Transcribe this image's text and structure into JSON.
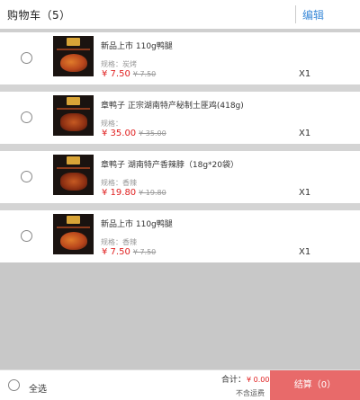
{
  "header": {
    "title": "购物车（5）",
    "edit_label": "编辑"
  },
  "items": [
    {
      "name": "新品上市 110g鸭腿",
      "spec": "规格：炭烤",
      "price": "¥ 7.50",
      "old_price": "¥ 7.50",
      "qty": "X1"
    },
    {
      "name": "章鸭子 正宗湖南特产秘制土匪鸡(418g)",
      "spec": "规格：",
      "price": "¥ 35.00",
      "old_price": "¥ 35.00",
      "qty": "X1"
    },
    {
      "name": "章鸭子 湖南特产香辣脖（18g*20袋）",
      "spec": "规格：香辣",
      "price": "¥ 19.80",
      "old_price": "¥ 19.80",
      "qty": "X1"
    },
    {
      "name": "新品上市 110g鸭腿",
      "spec": "规格：香辣",
      "price": "¥ 7.50",
      "old_price": "¥ 7.50",
      "qty": "X1"
    }
  ],
  "footer": {
    "select_all_label": "全选",
    "total_label": "合计：",
    "total_amount": "¥ 0.00",
    "shipping_note": "不含运费",
    "checkout_label": "结算（0）"
  },
  "colors": {
    "accent": "#3b8ad8",
    "price": "#e02020",
    "checkout": "#e86a6a"
  }
}
